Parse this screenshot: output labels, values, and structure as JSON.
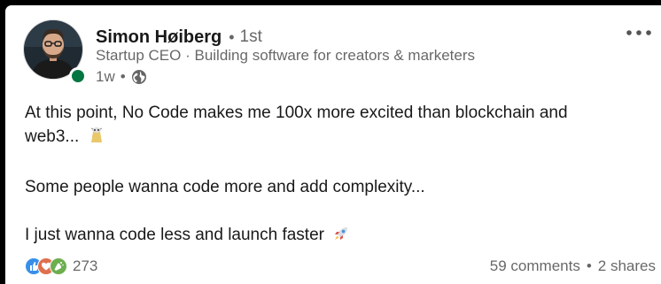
{
  "author": {
    "name": "Simon Høiberg",
    "separator": "•",
    "degree": "1st",
    "headline": "Startup CEO · Building software for creators & marketers",
    "age": "1w",
    "meta_separator": "•",
    "status_color": "#057642"
  },
  "post": {
    "lines": [
      "At this point, No Code makes me 100x more excited than blockchain and",
      "web3... ",
      "",
      "Some people wanna code more and add complexity...",
      "",
      "I just wanna code less and launch faster "
    ],
    "emojis": [
      "cow-bag-emoji",
      "rocket-emoji"
    ]
  },
  "footer": {
    "reaction_icons": [
      "like-icon",
      "love-icon",
      "celebrate-icon"
    ],
    "reaction_count": "273",
    "comments": "59 comments",
    "separator": "•",
    "shares": "2 shares"
  },
  "colors": {
    "like": "#378fe9",
    "love": "#df704d",
    "celebrate": "#6dae4f",
    "status": "#057642"
  }
}
